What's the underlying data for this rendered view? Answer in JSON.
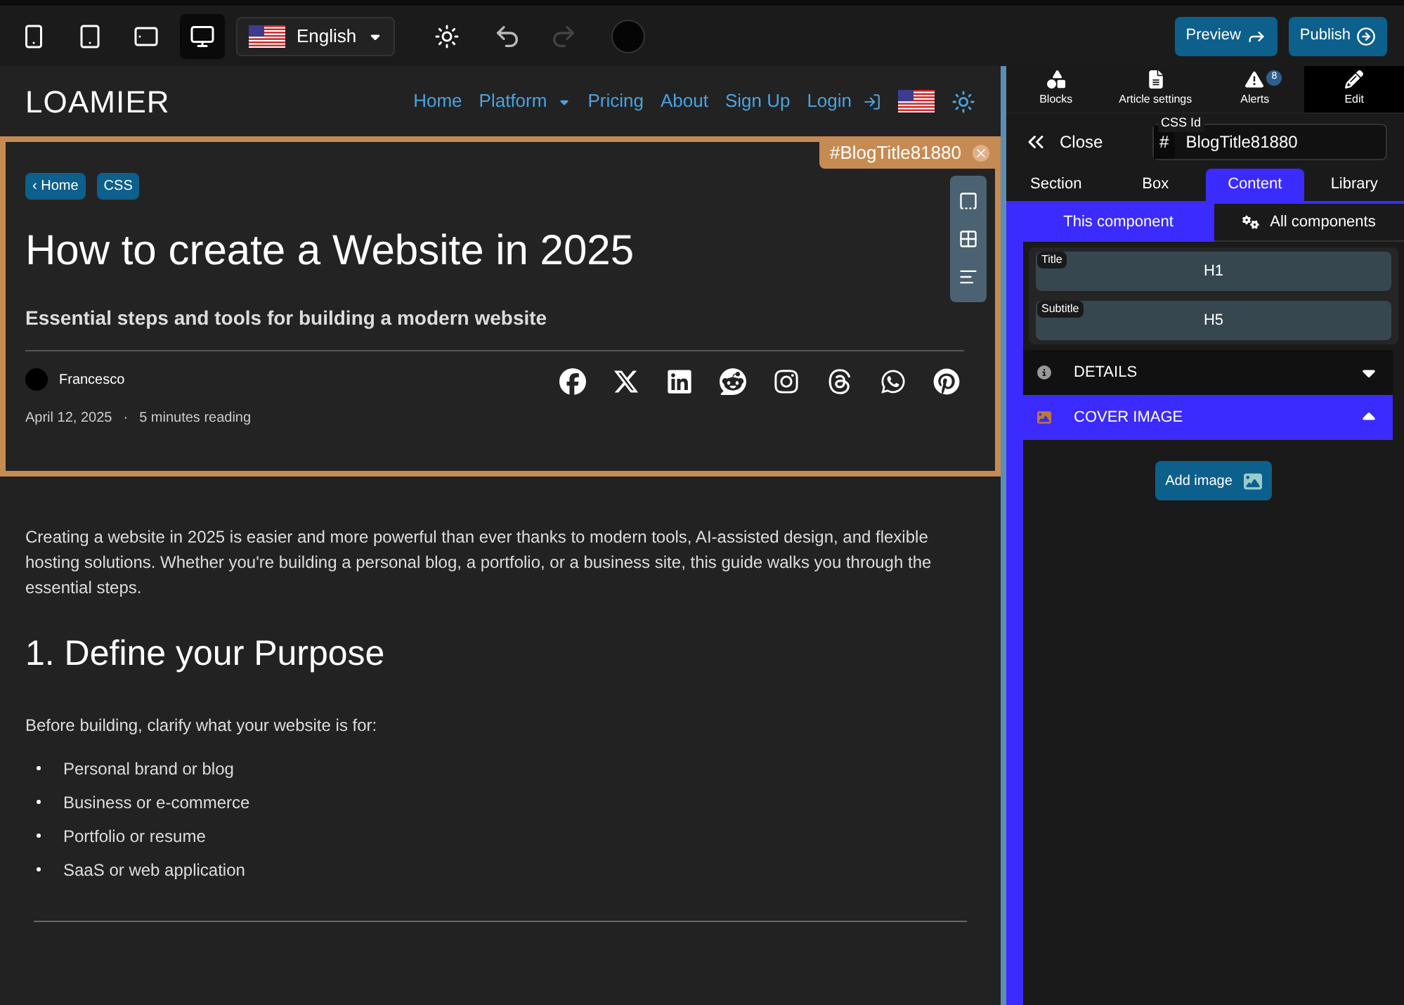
{
  "toolbar": {
    "devices": [
      {
        "kind": "phone",
        "selected": false
      },
      {
        "kind": "tablet",
        "selected": false
      },
      {
        "kind": "landscape",
        "selected": false
      },
      {
        "kind": "desktop",
        "selected": true
      }
    ],
    "language": "English",
    "preview": "Preview",
    "publish": "Publish"
  },
  "site": {
    "logo": "LOAMIER",
    "nav": [
      {
        "label": "Home",
        "kind": "link"
      },
      {
        "label": "Platform",
        "kind": "dropdown"
      },
      {
        "label": "Pricing",
        "kind": "link"
      },
      {
        "label": "About",
        "kind": "link"
      },
      {
        "label": "Sign Up",
        "kind": "link"
      },
      {
        "label": "Login",
        "kind": "login"
      }
    ]
  },
  "header": {
    "css_tag": "#BlogTitle81880",
    "breadcrumbs": [
      "‹ Home",
      "CSS"
    ],
    "title": "How to create a Website in 2025",
    "subtitle": "Essential steps and tools for building a modern website",
    "author": "Francesco",
    "date": "April 12, 2025",
    "separator": "·",
    "reading": "5 minutes reading",
    "social": [
      {
        "kind": "facebook"
      },
      {
        "kind": "x"
      },
      {
        "kind": "linkedin"
      },
      {
        "kind": "reddit"
      },
      {
        "kind": "instagram"
      },
      {
        "kind": "threads"
      },
      {
        "kind": "whatsapp"
      },
      {
        "kind": "pinterest"
      }
    ]
  },
  "article": {
    "intro": "Creating a website in 2025 is easier and more powerful than ever thanks to modern tools, AI-assisted design, and flexible hosting solutions. Whether you're building a personal blog, a portfolio, or a business site, this guide walks you through the essential steps.",
    "heading": "1. Define your Purpose",
    "lead": "Before building, clarify what your website is for:",
    "bullets": [
      "Personal brand or blog",
      "Business or e-commerce",
      "Portfolio or resume",
      "SaaS or web application"
    ]
  },
  "panel": {
    "top_tabs": [
      {
        "label": "Blocks",
        "kind": "blocks",
        "selected": false
      },
      {
        "label": "Article settings",
        "kind": "doc",
        "selected": false
      },
      {
        "label": "Alerts",
        "kind": "alert",
        "badge": "8",
        "selected": false
      },
      {
        "label": "Edit",
        "kind": "edit",
        "selected": true
      }
    ],
    "close": "Close",
    "css_id": {
      "label": "CSS Id",
      "prefix": "#",
      "value": "BlogTitle81880"
    },
    "section_tabs": [
      {
        "label": "Section",
        "selected": false
      },
      {
        "label": "Box",
        "selected": false
      },
      {
        "label": "Content",
        "selected": true
      },
      {
        "label": "Library",
        "selected": false
      }
    ],
    "sub_tabs": [
      {
        "label": "This component",
        "selected": true
      },
      {
        "label": "All components",
        "selected": false
      }
    ],
    "fields": [
      {
        "label": "Title",
        "value": "H1"
      },
      {
        "label": "Subtitle",
        "value": "H5"
      }
    ],
    "accordions": [
      {
        "label": "DETAILS",
        "kind": "info",
        "expanded": false
      },
      {
        "label": "COVER IMAGE",
        "kind": "image",
        "expanded": true
      }
    ],
    "add_image": "Add image"
  }
}
